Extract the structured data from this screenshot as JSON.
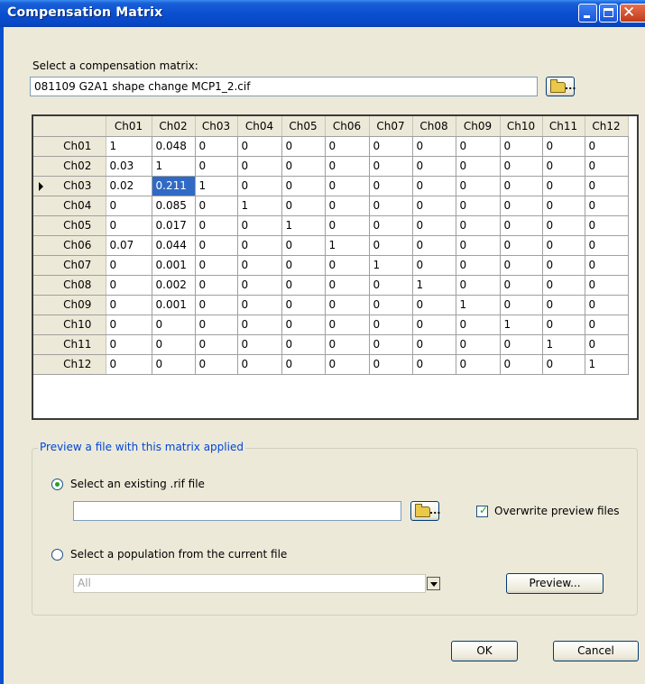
{
  "window": {
    "title": "Compensation Matrix"
  },
  "matrix_select": {
    "label": "Select a compensation matrix:",
    "value": "081109 G2A1 shape change MCP1_2.cif",
    "browse_dots": "..."
  },
  "grid": {
    "columns": [
      "Ch01",
      "Ch02",
      "Ch03",
      "Ch04",
      "Ch05",
      "Ch06",
      "Ch07",
      "Ch08",
      "Ch09",
      "Ch10",
      "Ch11",
      "Ch12"
    ],
    "current_row": 2,
    "selected_cell": {
      "row": 2,
      "col": 1
    },
    "rows": [
      {
        "header": "Ch01",
        "cells": [
          "1",
          "0.048",
          "0",
          "0",
          "0",
          "0",
          "0",
          "0",
          "0",
          "0",
          "0",
          "0"
        ]
      },
      {
        "header": "Ch02",
        "cells": [
          "0.03",
          "1",
          "0",
          "0",
          "0",
          "0",
          "0",
          "0",
          "0",
          "0",
          "0",
          "0"
        ]
      },
      {
        "header": "Ch03",
        "cells": [
          "0.02",
          "0.211",
          "1",
          "0",
          "0",
          "0",
          "0",
          "0",
          "0",
          "0",
          "0",
          "0"
        ]
      },
      {
        "header": "Ch04",
        "cells": [
          "0",
          "0.085",
          "0",
          "1",
          "0",
          "0",
          "0",
          "0",
          "0",
          "0",
          "0",
          "0"
        ]
      },
      {
        "header": "Ch05",
        "cells": [
          "0",
          "0.017",
          "0",
          "0",
          "1",
          "0",
          "0",
          "0",
          "0",
          "0",
          "0",
          "0"
        ]
      },
      {
        "header": "Ch06",
        "cells": [
          "0.07",
          "0.044",
          "0",
          "0",
          "0",
          "1",
          "0",
          "0",
          "0",
          "0",
          "0",
          "0"
        ]
      },
      {
        "header": "Ch07",
        "cells": [
          "0",
          "0.001",
          "0",
          "0",
          "0",
          "0",
          "1",
          "0",
          "0",
          "0",
          "0",
          "0"
        ]
      },
      {
        "header": "Ch08",
        "cells": [
          "0",
          "0.002",
          "0",
          "0",
          "0",
          "0",
          "0",
          "1",
          "0",
          "0",
          "0",
          "0"
        ]
      },
      {
        "header": "Ch09",
        "cells": [
          "0",
          "0.001",
          "0",
          "0",
          "0",
          "0",
          "0",
          "0",
          "1",
          "0",
          "0",
          "0"
        ]
      },
      {
        "header": "Ch10",
        "cells": [
          "0",
          "0",
          "0",
          "0",
          "0",
          "0",
          "0",
          "0",
          "0",
          "1",
          "0",
          "0"
        ]
      },
      {
        "header": "Ch11",
        "cells": [
          "0",
          "0",
          "0",
          "0",
          "0",
          "0",
          "0",
          "0",
          "0",
          "0",
          "1",
          "0"
        ]
      },
      {
        "header": "Ch12",
        "cells": [
          "0",
          "0",
          "0",
          "0",
          "0",
          "0",
          "0",
          "0",
          "0",
          "0",
          "0",
          "1"
        ]
      }
    ]
  },
  "preview": {
    "group_title": "Preview a file with this matrix applied",
    "option_existing": {
      "label": "Select an existing .rif file",
      "selected": true,
      "value": ""
    },
    "overwrite": {
      "label": "Overwrite preview files",
      "checked": true
    },
    "option_population": {
      "label": "Select a population from the current file",
      "selected": false,
      "value": "All"
    },
    "preview_button": "Preview..."
  },
  "footer": {
    "ok": "OK",
    "cancel": "Cancel"
  },
  "colors": {
    "titlebar": "#0a4fd0",
    "dialog_bg": "#ece9d8",
    "selection": "#316ac5",
    "group_title": "#0046d5"
  }
}
